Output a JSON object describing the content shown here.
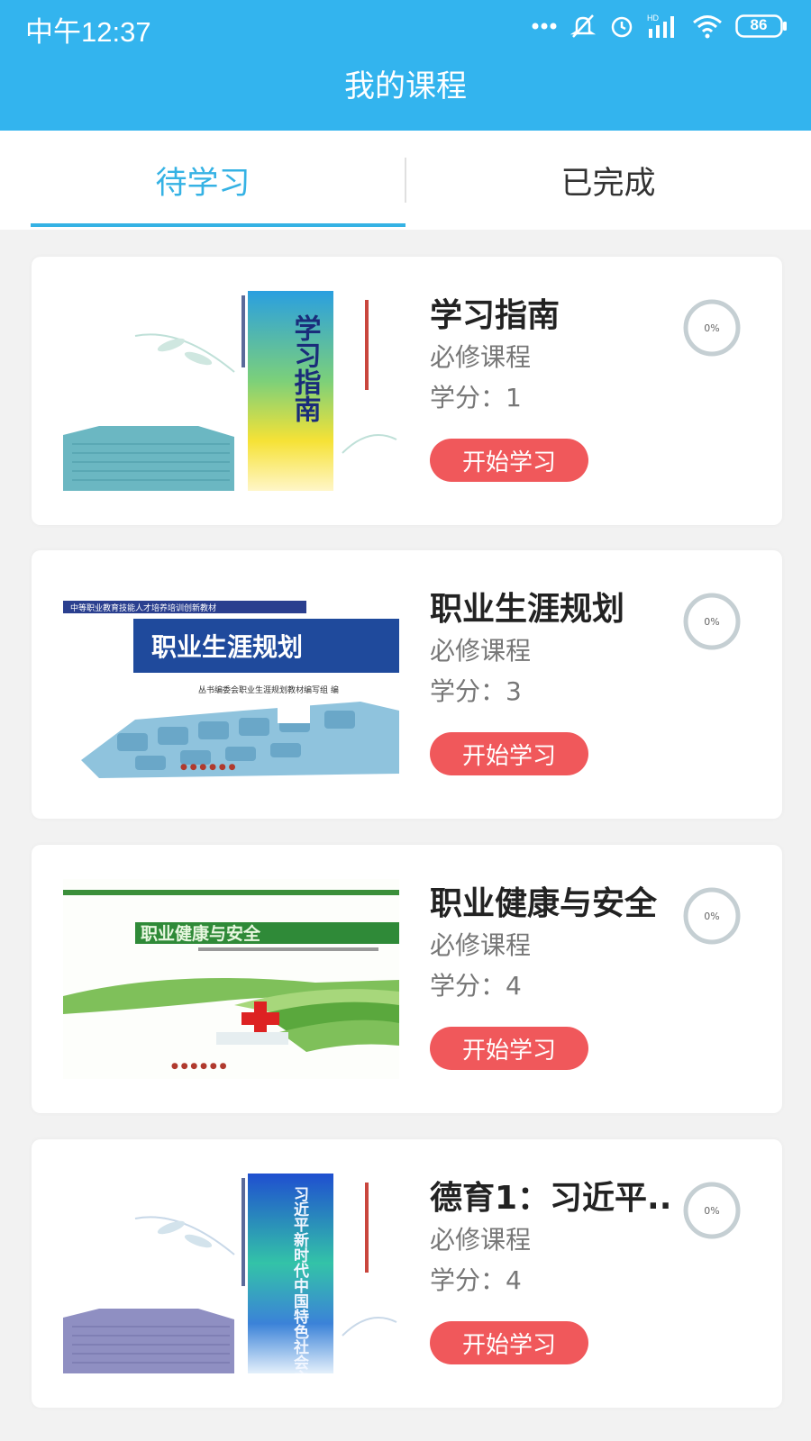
{
  "status_bar": {
    "time": "中午12:37",
    "battery": "86",
    "icons": [
      "more-dots-icon",
      "mute-bell-icon",
      "alarm-icon",
      "signal-hd-icon",
      "wifi-icon",
      "battery-icon"
    ]
  },
  "header": {
    "title": "我的课程"
  },
  "tabs": [
    {
      "label": "待学习",
      "active": true
    },
    {
      "label": "已完成",
      "active": false
    }
  ],
  "courses": [
    {
      "name": "学习指南",
      "type": "必修课程",
      "credit": "学分：1",
      "button": "开始学习",
      "progress": "0%",
      "cover_title": "学习指南",
      "cover_kind": "vertical-gradient"
    },
    {
      "name": "职业生涯规划",
      "type": "必修课程",
      "credit": "学分：3",
      "button": "开始学习",
      "progress": "0%",
      "cover_title": "职业生涯规划",
      "cover_banner": "中等职业教育技能人才培养培训创新教材",
      "cover_editor": "丛书编委会职业生涯规划教材编写组 编",
      "cover_kind": "puzzle"
    },
    {
      "name": "职业健康与安全",
      "type": "必修课程",
      "credit": "学分：4",
      "button": "开始学习",
      "progress": "0%",
      "cover_title": "职业健康与安全",
      "cover_kind": "green-ring"
    },
    {
      "name": "德育1：习近平...",
      "type": "必修课程",
      "credit": "学分：4",
      "button": "开始学习",
      "progress": "0%",
      "cover_title": "习近平新时代中国特色社会主义思想",
      "cover_kind": "vertical-blue"
    }
  ],
  "colors": {
    "header": "#33b4ee",
    "tab_active": "#35b2e4",
    "button": "#f0585b",
    "ring": "#c5cfd3"
  }
}
